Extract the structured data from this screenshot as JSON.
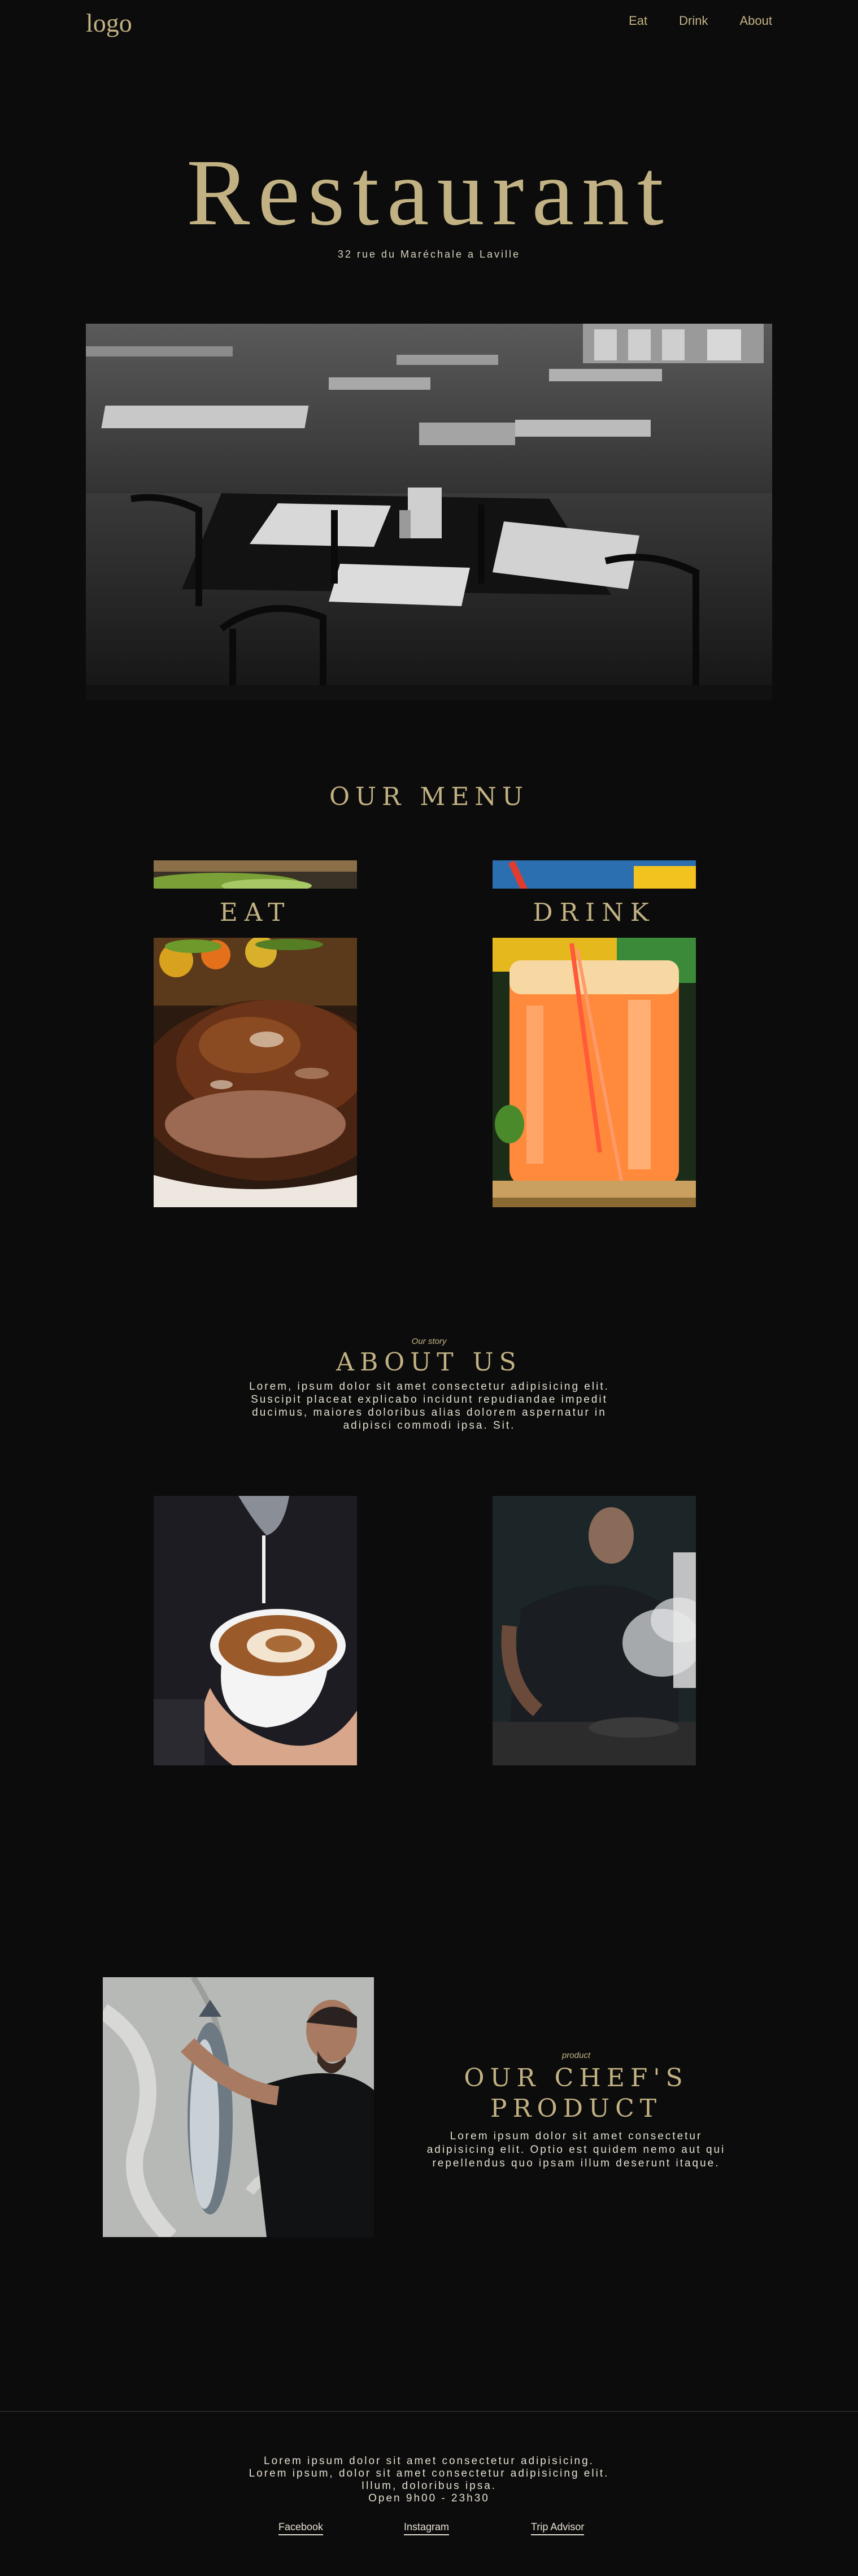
{
  "header": {
    "logo": "logo",
    "nav": [
      "Eat",
      "Drink",
      "About"
    ]
  },
  "hero": {
    "title": "Restaurant",
    "address": "32 rue du Maréchale a Laville"
  },
  "menu": {
    "title": "OUR MENU",
    "eat_label": "EAT",
    "drink_label": "DRINK"
  },
  "about": {
    "eyebrow": "Our story",
    "title": "ABOUT US",
    "lines": [
      "Lorem, ipsum dolor sit amet consectetur adipisicing elit.",
      "Suscipit placeat explicabo incidunt repudiandae impedit",
      "ducimus, maiores doloribus alias dolorem aspernatur in",
      "adipisci commodi ipsa. Sit."
    ]
  },
  "chef": {
    "eyebrow": "product",
    "title_line1": "OUR CHEF'S",
    "title_line2": "PRODUCT",
    "lines": [
      "Lorem ipsum dolor sit amet consectetur",
      "adipisicing elit. Optio est quidem nemo aut qui",
      "repellendus quo ipsam illum deserunt itaque."
    ]
  },
  "footer": {
    "lines": [
      "Lorem ipsum dolor sit amet consectetur adipisicing.",
      "Lorem ipsum, dolor sit amet consectetur adipisicing elit.",
      "Illum, doloribus ipsa.",
      "Open 9h00 - 23h30"
    ],
    "links": [
      "Facebook",
      "Instagram",
      "Trip Advisor"
    ]
  },
  "colors": {
    "background": "#0c0c0c",
    "accent_gold": "#c2b283",
    "body_text": "#e4dfd0"
  }
}
